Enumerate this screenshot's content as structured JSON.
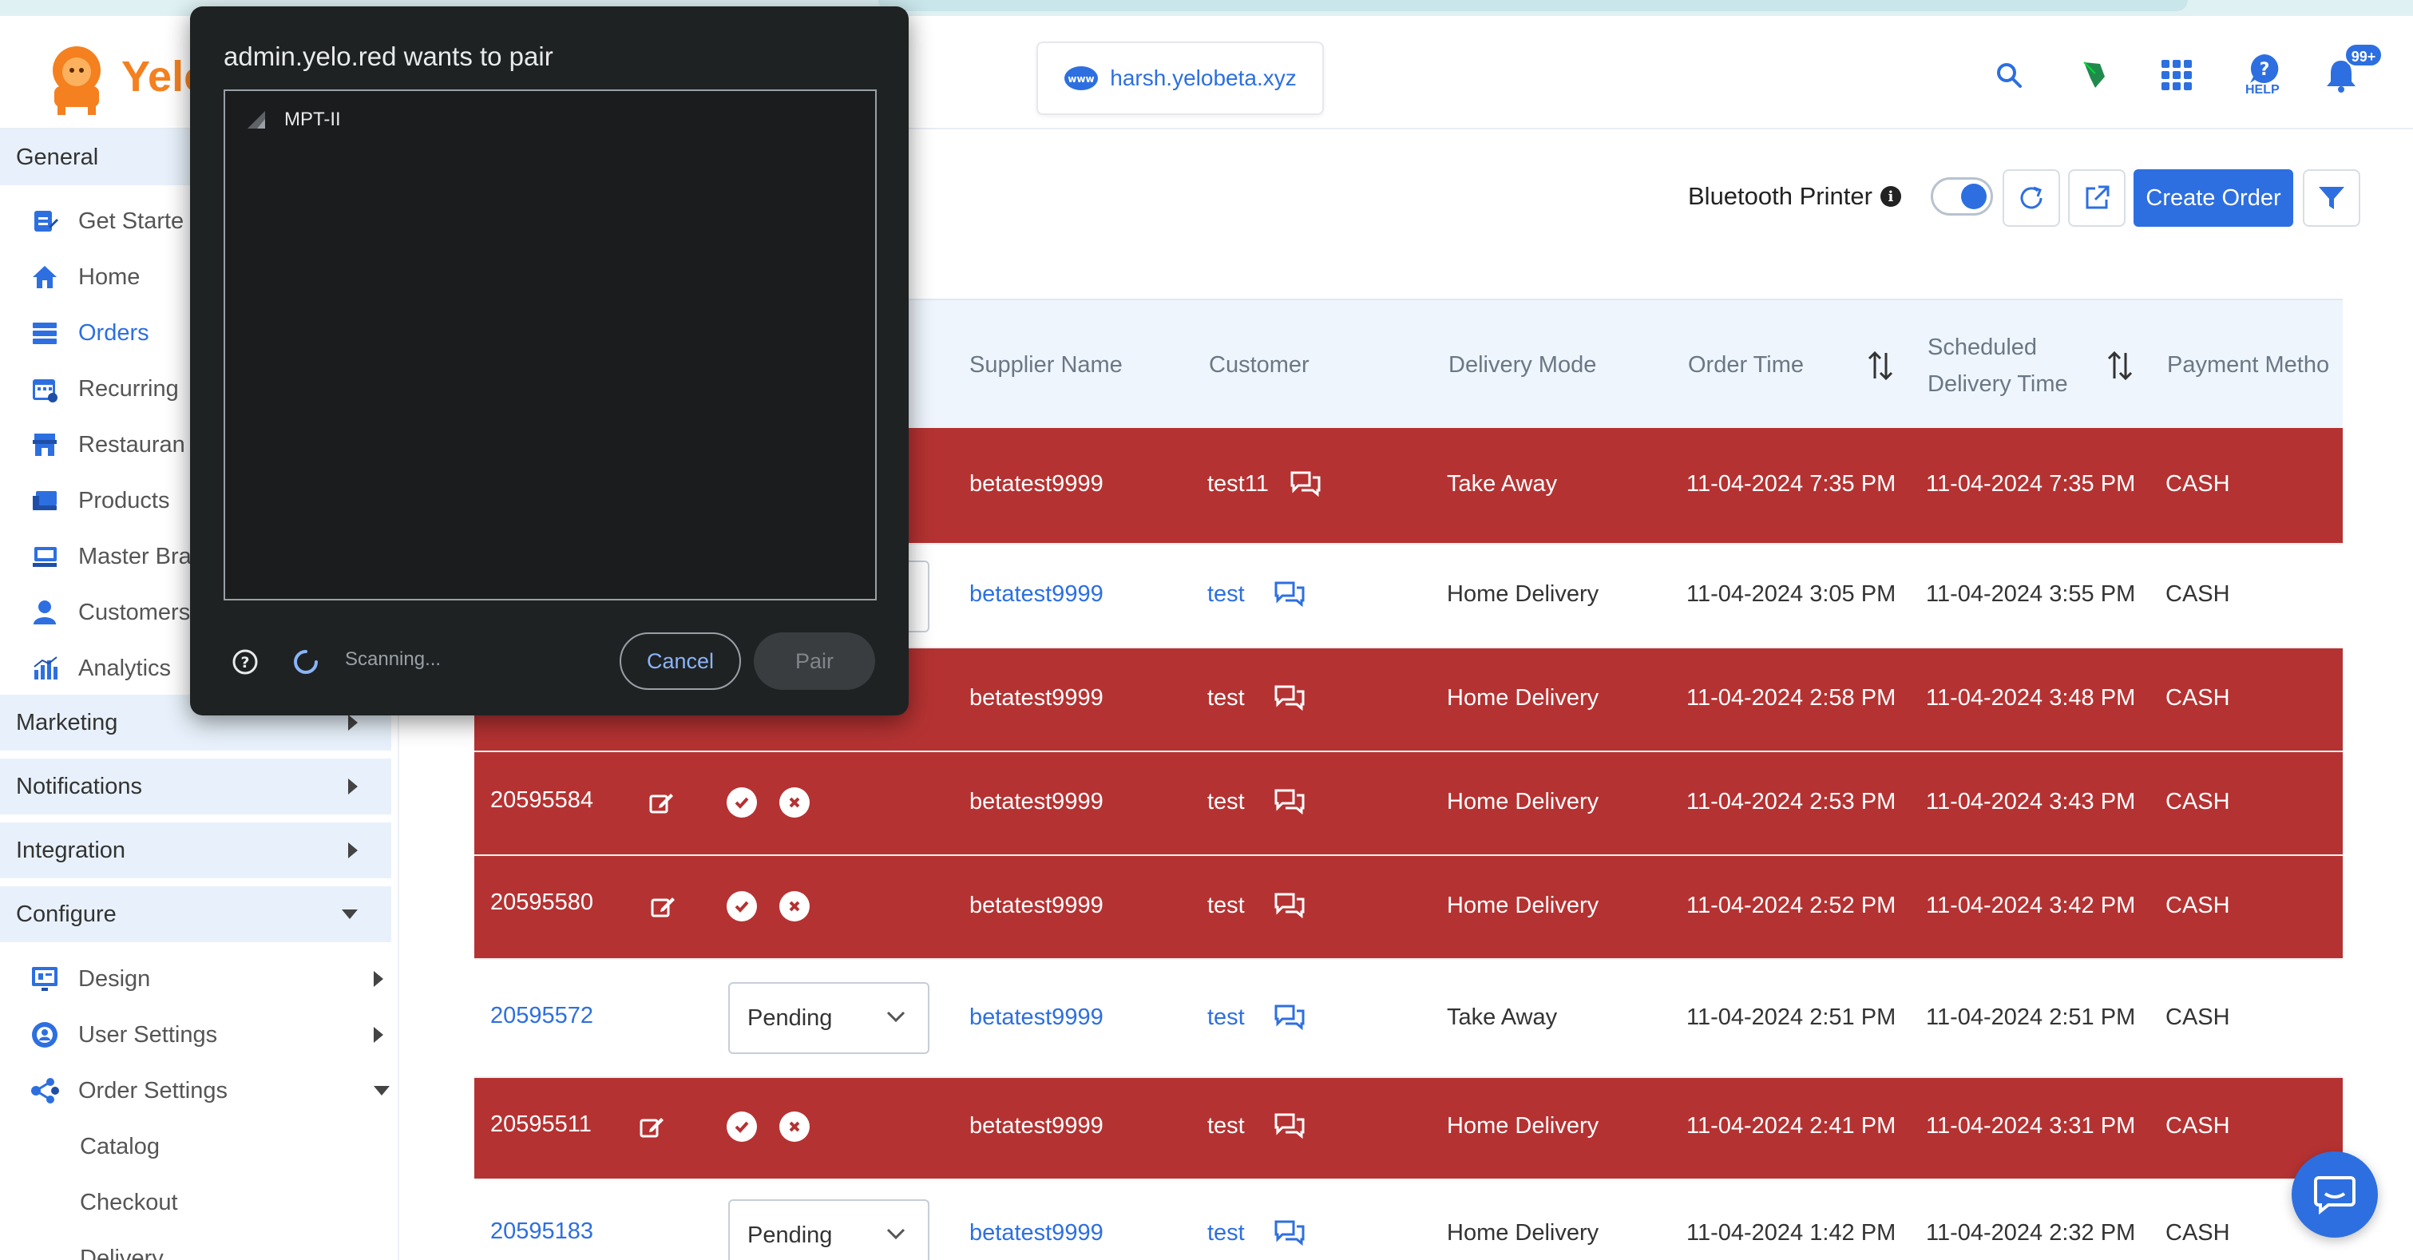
{
  "header": {
    "logo_text": "Yelo",
    "domain": "harsh.yelobeta.xyz",
    "help_label": "HELP",
    "notification_badge": "99+"
  },
  "sidebar": {
    "general": "General",
    "items": [
      {
        "label": "Get Starte",
        "icon": "clipboard-edit-icon"
      },
      {
        "label": "Home",
        "icon": "home-icon"
      },
      {
        "label": "Orders",
        "icon": "list-icon"
      },
      {
        "label": "Recurring",
        "icon": "calendar-icon"
      },
      {
        "label": "Restauran",
        "icon": "store-icon"
      },
      {
        "label": "Products",
        "icon": "products-icon"
      },
      {
        "label": "Master Bra",
        "icon": "master-brand-icon"
      },
      {
        "label": "Customers",
        "icon": "user-icon"
      },
      {
        "label": "Analytics",
        "icon": "bar-chart-icon"
      }
    ],
    "marketing": "Marketing",
    "notifications": "Notifications",
    "integration": "Integration",
    "configure": "Configure",
    "configure_items": [
      {
        "label": "Design",
        "icon": "design-icon"
      },
      {
        "label": "User Settings",
        "icon": "user-settings-icon"
      },
      {
        "label": "Order Settings",
        "icon": "order-settings-icon"
      }
    ],
    "order_settings_sub": [
      "Catalog",
      "Checkout",
      "Delivery"
    ]
  },
  "toolbar": {
    "bluetooth_label": "Bluetooth Printer",
    "create_order": "Create Order"
  },
  "table": {
    "headers": {
      "supplier": "Supplier Name",
      "customer": "Customer",
      "delivery_mode": "Delivery Mode",
      "order_time": "Order Time",
      "scheduled_1": "Scheduled",
      "scheduled_2": "Delivery Time",
      "payment": "Payment Metho"
    },
    "rows": [
      {
        "id": "",
        "status": "",
        "supplier": "betatest9999",
        "customer": "test11",
        "mode": "Take Away",
        "order_time": "11-04-2024 7:35 PM",
        "scheduled": "11-04-2024 7:35 PM",
        "payment": "CASH"
      },
      {
        "id": "",
        "status": "",
        "supplier": "betatest9999",
        "customer": "test",
        "mode": "Home Delivery",
        "order_time": "11-04-2024 3:05 PM",
        "scheduled": "11-04-2024 3:55 PM",
        "payment": "CASH"
      },
      {
        "id": "",
        "status": "",
        "supplier": "betatest9999",
        "customer": "test",
        "mode": "Home Delivery",
        "order_time": "11-04-2024 2:58 PM",
        "scheduled": "11-04-2024 3:48 PM",
        "payment": "CASH"
      },
      {
        "id": "20595584",
        "status": "",
        "supplier": "betatest9999",
        "customer": "test",
        "mode": "Home Delivery",
        "order_time": "11-04-2024 2:53 PM",
        "scheduled": "11-04-2024 3:43 PM",
        "payment": "CASH"
      },
      {
        "id": "20595580",
        "status": "",
        "supplier": "betatest9999",
        "customer": "test",
        "mode": "Home Delivery",
        "order_time": "11-04-2024 2:52 PM",
        "scheduled": "11-04-2024 3:42 PM",
        "payment": "CASH"
      },
      {
        "id": "20595572",
        "status": "Pending",
        "supplier": "betatest9999",
        "customer": "test",
        "mode": "Take Away",
        "order_time": "11-04-2024 2:51 PM",
        "scheduled": "11-04-2024 2:51 PM",
        "payment": "CASH"
      },
      {
        "id": "20595511",
        "status": "",
        "supplier": "betatest9999",
        "customer": "test",
        "mode": "Home Delivery",
        "order_time": "11-04-2024 2:41 PM",
        "scheduled": "11-04-2024 3:31 PM",
        "payment": "CASH"
      },
      {
        "id": "20595183",
        "status": "Pending",
        "supplier": "betatest9999",
        "customer": "test",
        "mode": "Home Delivery",
        "order_time": "11-04-2024 1:42 PM",
        "scheduled": "11-04-2024 2:32 PM",
        "payment": "CASH"
      }
    ]
  },
  "dialog": {
    "title": "admin.yelo.red wants to pair",
    "device": "MPT-II",
    "scanning": "Scanning...",
    "cancel": "Cancel",
    "pair": "Pair"
  },
  "colors": {
    "accent": "#2d6fe0",
    "alert_row": "#b53232",
    "brand_orange": "#f4801f",
    "dialog_bg": "#1f2223"
  }
}
